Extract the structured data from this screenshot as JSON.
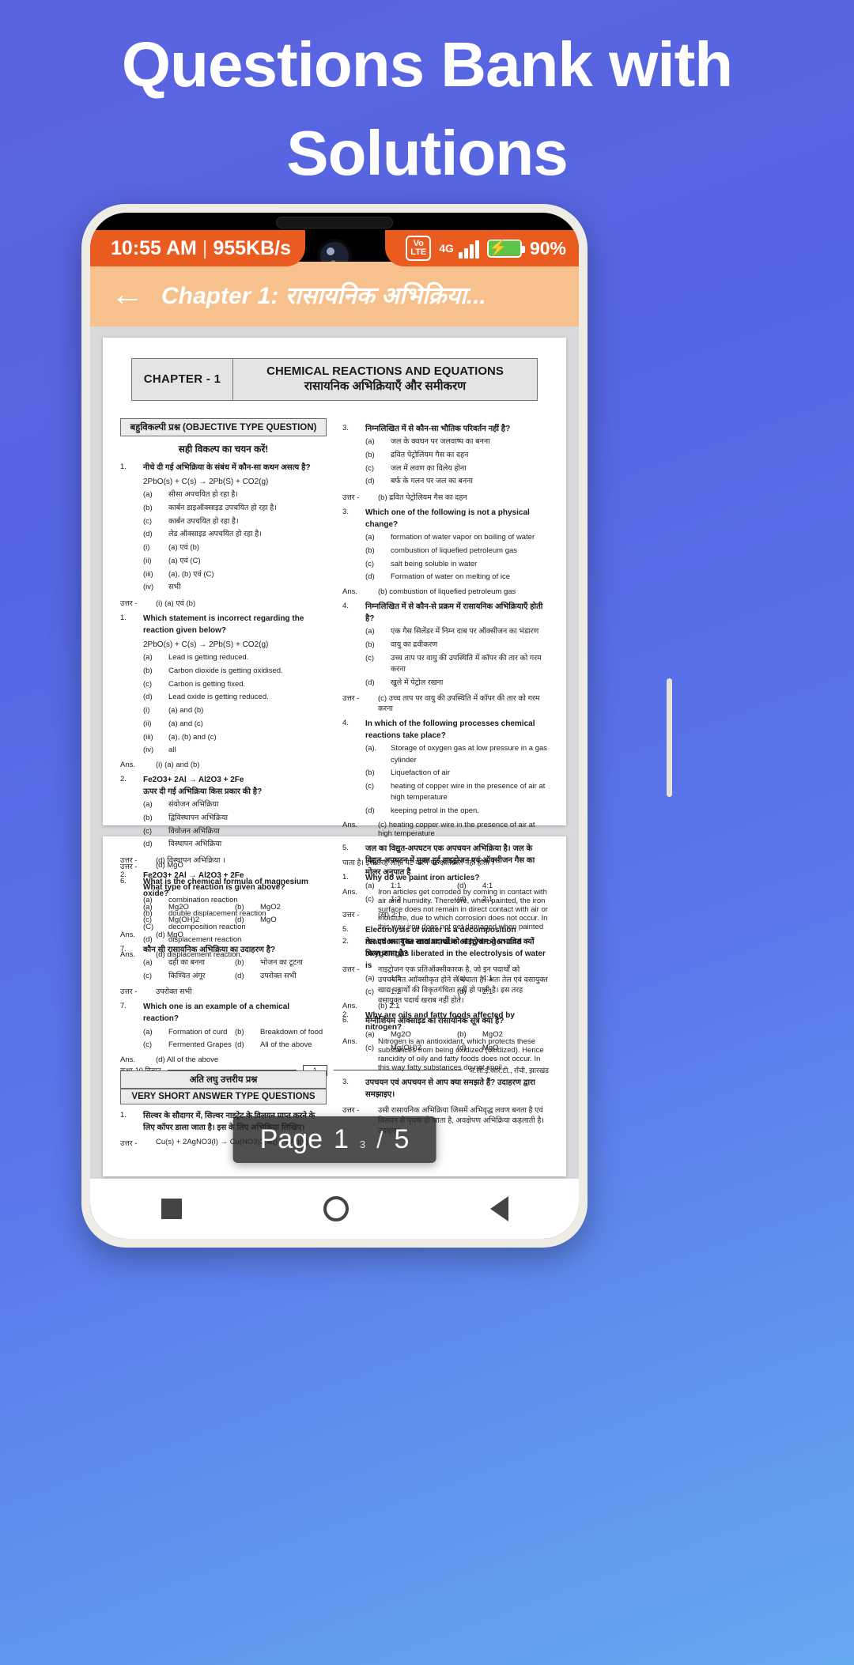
{
  "promo": {
    "line1": "Questions Bank with",
    "line2": "Solutions"
  },
  "colors": {
    "background_gradient_top": "#5b64e0",
    "background_gradient_bottom": "#64a8f0",
    "status_bar": "#ea5b20",
    "app_bar": "#f6c18d",
    "battery_fill": "#5ec44a"
  },
  "statusbar": {
    "time": "10:55 AM",
    "separator": "|",
    "data_usage": "955KB/s",
    "volte_line1": "Vo",
    "volte_line2": "LTE",
    "network": "4G",
    "battery_percent": "90%",
    "charging_glyph": "⚡"
  },
  "appbar": {
    "back_glyph": "←",
    "title": "Chapter 1: रासायनिक अभिक्रिया..."
  },
  "page_indicator": {
    "label": "Page",
    "current": "1",
    "current_sup": "3",
    "slash": "/",
    "total": "5"
  },
  "navbar": {
    "recents": "square-icon",
    "home": "circle-icon",
    "back": "triangle-back-icon"
  },
  "document": {
    "chapter_box": {
      "chapter_label": "CHAPTER - 1",
      "title_en": "CHEMICAL REACTIONS AND EQUATIONS",
      "title_hi": "रासायनिक अभिक्रियाएँ और समीकरण"
    },
    "left_column": {
      "objective_bar": "बहुविकल्पी प्रश्न (OBJECTIVE TYPE QUESTION)",
      "subhead": "सही विकल्प का चयन करें!",
      "questions": [
        {
          "num": "1.",
          "text": "नीचे दी गई अभिक्रिया के संबंध में कौन-सा कथन असत्य है?",
          "equation": "2PbO(s) + C(s) → 2Pb(S) + CO2(g)",
          "options": [
            {
              "label": "(a)",
              "text": "सीसा अपचयित हो रहा है।"
            },
            {
              "label": "(b)",
              "text": "कार्बन डाइऑक्साइड उपचयित हो रहा है।"
            },
            {
              "label": "(c)",
              "text": "कार्बन उपचयित हो रहा है।"
            },
            {
              "label": "(d)",
              "text": "लेड ऑक्साइड अपचयित हो रहा है।"
            }
          ],
          "subopts": [
            {
              "label": "(i)",
              "text": "(a) एवं (b)"
            },
            {
              "label": "(ii)",
              "text": "(a) एवं (C)"
            },
            {
              "label": "(iii)",
              "text": "(a), (b) एवं (C)"
            },
            {
              "label": "(iv)",
              "text": "सभी"
            }
          ],
          "answer_label": "उत्तर -",
          "answer": "(i)  (a) एवं (b)"
        },
        {
          "num": "1.",
          "text": "Which statement is incorrect regarding the reaction given below?",
          "equation": "2PbO(s) + C(s) → 2Pb(S) + CO2(g)",
          "options": [
            {
              "label": "(a)",
              "text": "Lead is getting reduced."
            },
            {
              "label": "(b)",
              "text": "Carbon dioxide is getting oxidised."
            },
            {
              "label": "(c)",
              "text": "Carbon is getting fixed."
            },
            {
              "label": "(d)",
              "text": "Lead oxide is getting reduced."
            }
          ],
          "subopts": [
            {
              "label": "(i)",
              "text": "(a) and (b)"
            },
            {
              "label": "(ii)",
              "text": "(a) and (c)"
            },
            {
              "label": "(iii)",
              "text": "(a), (b) and (c)"
            },
            {
              "label": "(iv)",
              "text": "all"
            }
          ],
          "answer_label": "Ans.",
          "answer": "(i)  (a) and (b)"
        },
        {
          "num": "2.",
          "text": "Fe2O3+ 2Al → Al2O3 + 2Fe",
          "text2": "ऊपर दी गई अभिक्रिया किस प्रकार की है?",
          "options": [
            {
              "label": "(a)",
              "text": "संयोजन अभिक्रिया"
            },
            {
              "label": "(b)",
              "text": "द्विविस्थापन अभिक्रिया"
            },
            {
              "label": "(c)",
              "text": "वियोजन अभिक्रिया"
            },
            {
              "label": "(d)",
              "text": "विस्थापन अभिक्रिया"
            }
          ],
          "answer_label": "उत्तर -",
          "answer": "(d)  विस्थापन अभिक्रिया ।"
        },
        {
          "num": "2.",
          "text": "Fe2O3+ 2Al → Al2O3 + 2Fe",
          "text2": "What type of reaction is given above?",
          "options": [
            {
              "label": "(a)",
              "text": "combination reaction"
            },
            {
              "label": "(b)",
              "text": "double displacement reaction"
            },
            {
              "label": "(C)",
              "text": "decomposition reaction"
            },
            {
              "label": "(d)",
              "text": "displacement reaction"
            }
          ],
          "answer_label": "Ans.",
          "answer": "(d)  displacement reaction."
        }
      ]
    },
    "right_column": {
      "questions": [
        {
          "num": "3.",
          "text": "निम्नलिखित में से कौन-सा भौतिक परिवर्तन नहीं है?",
          "options": [
            {
              "label": "(a)",
              "text": "जल के क्वथन पर जलवाष्प का बनना"
            },
            {
              "label": "(b)",
              "text": "द्रवित पेट्रोलियम गैस का दहन"
            },
            {
              "label": "(c)",
              "text": "जल में लवण का विलेय होना"
            },
            {
              "label": "(d)",
              "text": "बर्फ के गलन पर जल का बनना"
            }
          ],
          "answer_label": "उत्तर -",
          "answer": "(b)  द्रवित पेट्रोलियम गैस का दहन"
        },
        {
          "num": "3.",
          "text": "Which one of the following is not a physical change?",
          "options": [
            {
              "label": "(a)",
              "text": "formation of water vapor on boiling of water"
            },
            {
              "label": "(b)",
              "text": "combustion of liquefied petroleum gas"
            },
            {
              "label": "(c)",
              "text": "salt being soluble in water"
            },
            {
              "label": "(d)",
              "text": "Formation of water on melting of ice"
            }
          ],
          "answer_label": "Ans.",
          "answer": "(b)  combustion of liquefied petroleum gas"
        },
        {
          "num": "4.",
          "text": "निम्नलिखित में से कौन-से प्रक्रम में रासायनिक अभिक्रियाएँ होती है?",
          "options": [
            {
              "label": "(a)",
              "text": "एक गैस सिलेंडर में निम्न दाब पर ऑक्सीजन का भंडारण"
            },
            {
              "label": "(b)",
              "text": "वायु का द्रवीकरण"
            },
            {
              "label": "(c)",
              "text": "उच्च ताप पर वायु की उपस्थिति में कॉपर की तार को गरम करना"
            },
            {
              "label": "(d)",
              "text": "खुले में पेट्रोल रखना"
            }
          ],
          "answer_label": "उत्तर -",
          "answer": "(c)  उच्च ताप पर वायु की उपस्थिति में कॉपर की तार को गरम करना"
        },
        {
          "num": "4.",
          "text": "In which of the following processes chemical reactions take place?",
          "options": [
            {
              "label": "(a).",
              "text": "Storage of oxygen gas at low pressure in a gas cylinder"
            },
            {
              "label": "(b)",
              "text": "Liquefaction of air"
            },
            {
              "label": "(c)",
              "text": "heating of copper wire in the presence of air at high temperature"
            },
            {
              "label": "(d)",
              "text": "keeping petrol in the open."
            }
          ],
          "answer_label": "Ans.",
          "answer": "(c)  heating copper wire in the presence of air at high temperature"
        },
        {
          "num": "5.",
          "text": "जल का विद्युत-अपघटन एक अपचयन अभिक्रिया है। जल के विद्युत-अपघटन में मुक्त हुई हाइड्रोजन एवं ऑक्सीजन गैस का मोलर अनुपात है",
          "optgrid": [
            {
              "label": "(a)",
              "text": "1:1"
            },
            {
              "label": "(d)",
              "text": "4:1"
            },
            {
              "label": "(c)",
              "text": "1:2"
            },
            {
              "label": "(d)",
              "text": "2:1"
            }
          ],
          "answer_label": "उत्तर -",
          "answer": "(ख) 2:1"
        },
        {
          "num": "5.",
          "text": "Electrolysis of water is a decomposition reaction. The molar ratio of hydrogen and oxygen gas liberated in the electrolysis of water is",
          "optgrid": [
            {
              "label": "(a)",
              "text": "1:1"
            },
            {
              "label": "(c)",
              "text": "4:1"
            },
            {
              "label": "(c)",
              "text": "1:2"
            },
            {
              "label": "(d)",
              "text": "2:1"
            }
          ],
          "answer_label": "Ans.",
          "answer": "(b)  2:1"
        },
        {
          "num": "6.",
          "text": "मैग्नीशियम ऑक्साइड का रासायनिक सूत्र क्या है?",
          "optgrid": [
            {
              "label": "(a)",
              "text": "Mg2O"
            },
            {
              "label": "(b)",
              "text": "MgO2"
            },
            {
              "label": "(c)",
              "text": "Mg(OH)2"
            },
            {
              "label": "(d)",
              "text": "MgO"
            }
          ]
        }
      ]
    },
    "footer": {
      "left": "कक्षा-10 विज्ञान",
      "page_number": "1",
      "right": "जे.सी.ई.आर.टी., राँची, झारखंड"
    },
    "page2": {
      "left_column": {
        "pre_answer_label": "उत्तर -",
        "pre_answer": "(d)  MgO",
        "questions": [
          {
            "num": "6.",
            "text": "What is the chemical formula of magnesium oxide?",
            "optgrid": [
              {
                "label": "(a)",
                "text": "Mg2O"
              },
              {
                "label": "(b)",
                "text": "MgO2"
              },
              {
                "label": "(c)",
                "text": "Mg(OH)2"
              },
              {
                "label": "(d)",
                "text": "MgO"
              }
            ],
            "answer_label": "Ans.",
            "answer": "(d)  MgO"
          },
          {
            "num": "7.",
            "text": "कौन सी रासायनिक अभिक्रिया का उदाहरण है?",
            "optgrid": [
              {
                "label": "(a)",
                "text": "दही का बनना"
              },
              {
                "label": "(b)",
                "text": "भोजन का टूटना"
              },
              {
                "label": "(c)",
                "text": "किण्वित अंगूर"
              },
              {
                "label": "(d)",
                "text": "उपरोक्त सभी"
              }
            ],
            "answer_label": "उत्तर -",
            "answer": "उपरोक्त सभी"
          },
          {
            "num": "7.",
            "text": "Which one is an example of a chemical reaction?",
            "optgrid": [
              {
                "label": "(a)",
                "text": "Formation of curd"
              },
              {
                "label": "(b)",
                "text": "Breakdown of food"
              },
              {
                "label": "(c)",
                "text": "Fermented Grapes"
              },
              {
                "label": "(d)",
                "text": "All of the above"
              }
            ],
            "answer_label": "Ans.",
            "answer": "(d)  All of the above"
          }
        ],
        "section_bar_hi": "अति लघु उत्तरीय प्रश्न",
        "section_bar_en": "VERY SHORT ANSWER TYPE QUESTIONS",
        "last_question_num": "1.",
        "last_question": "सिल्वर के सौदागर में, सिल्वर नाइट्रेट के विलयन प्राप्त करने के लिए कॉपर डाला जाता है। इस के लिए अभिक्रिया लिखिए।",
        "last_answer_label": "उत्तर -",
        "last_answer": "Cu(s) + 2AgNO3(l) → Cu(NO3)2(aq) + 2Ag(s)"
      },
      "right_column": {
        "pre_text": "पाता है। इस तरह लोहा पेट करने पर क्षतिग्रस्त नहीं होता ।",
        "questions": [
          {
            "num": "1.",
            "text": "Why do we paint iron articles?",
            "answer_label": "Ans.",
            "answer": "Iron articles get corroded by coming in contact with air and humidity. Therefore, when painted, the iron surface does not remain in direct contact with air or moisture, due to which corrosion does not occur. In this way iron does not get damaged when painted"
          },
          {
            "num": "2.",
            "text": "तेल एवं वसायुक्त खाद्य पदार्थों को नाइट्रोजन से प्रभावित क्यों किया जाता है?",
            "answer_label": "उत्तर -",
            "answer": "नाइट्रोजन एक प्रतिऑक्सीकारक है, जो इन पदार्थों को उपचयनित आॉक्सीकृत होने से बचाता है। अतः तेल एवं वसायुक्त खाद्य पदार्थों की विकृतगंधिता नहीं हो पाती है। इस तरह वसायुक्त पदार्थ खराब नहीं होते।"
          },
          {
            "num": "2.",
            "text": "Why are oils and fatty foods affected by nitrogen?",
            "answer_label": "Ans.",
            "answer": "Nitrogen is an antioxidant, which protects these substances from being oxidized (oxidized). Hence rancidity of oily and fatty foods does not occur. In this way fatty substances do not spoil."
          },
          {
            "num": "3.",
            "text": "उपचयन एवं अपचयन से आप क्या समझते हैं? उदाहरण द्वारा समझाइए।",
            "answer_label": "उत्तर -",
            "answer": "उसी रासायनिक अभिक्रिया जिसमें अभिवृद्ध लवण बनता है एवं विलयन से पृथक हो जाता है, अवक्षेपण अभिक्रिया कहलाती है। उदाहरण-"
          }
        ]
      }
    }
  }
}
